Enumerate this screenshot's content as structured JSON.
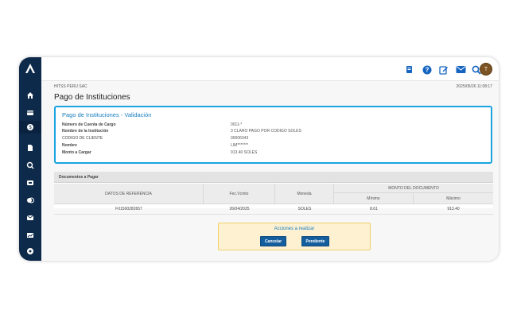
{
  "header": {
    "company": "HITSS PERU SAC",
    "datetime": "2025/05/26 11:08:17",
    "avatar_initial": "T"
  },
  "page": {
    "title": "Pago de Instituciones"
  },
  "validation": {
    "title": "Pago de Instituciones - Validación",
    "rows": [
      {
        "label": "Número de Cuenta de Cargo",
        "value": "0011-*"
      },
      {
        "label": "Nombre de la Institución",
        "value": "3 CLARO PAGO POR CODIGO SOLES"
      },
      {
        "label": "CODIGO DE CLIENTE",
        "value": "00006343"
      },
      {
        "label": "Nombre",
        "value": "LIM*******"
      },
      {
        "label": "Monto a Cargar",
        "value": "913.40   SOLES"
      }
    ]
  },
  "documents": {
    "title": "Documentos a Pagar",
    "columns": {
      "ref": "DATOS DE REFERENCIA",
      "due": "Fec.Vcmto",
      "currency": "Moneda",
      "amount_group": "MONTO DEL DOCUMENTO",
      "min": "Mínimo",
      "max": "Máximo"
    },
    "rows": [
      {
        "ref": "F01500282657",
        "due": "26/04/2025",
        "currency": "SOLES",
        "min": "8.61",
        "max": "913.40"
      }
    ]
  },
  "actions": {
    "title": "Acciones a realizar",
    "cancel_label": "Cancelar",
    "pending_label": "Pendiente"
  },
  "colors": {
    "sidebar": "#0d2a4a",
    "accent": "#1aa3e0",
    "button": "#155e9e",
    "actions_bg": "#fdf1d2"
  },
  "icons": {
    "sidebar": [
      "home-icon",
      "card-icon",
      "payment-icon",
      "document-icon",
      "search-money-icon",
      "transfer-icon",
      "exchange-icon",
      "mail-card-icon",
      "chart-icon",
      "settings-icon"
    ],
    "topbar": [
      "bank-icon",
      "help-icon",
      "edit-icon",
      "mail-icon",
      "search-icon"
    ]
  }
}
